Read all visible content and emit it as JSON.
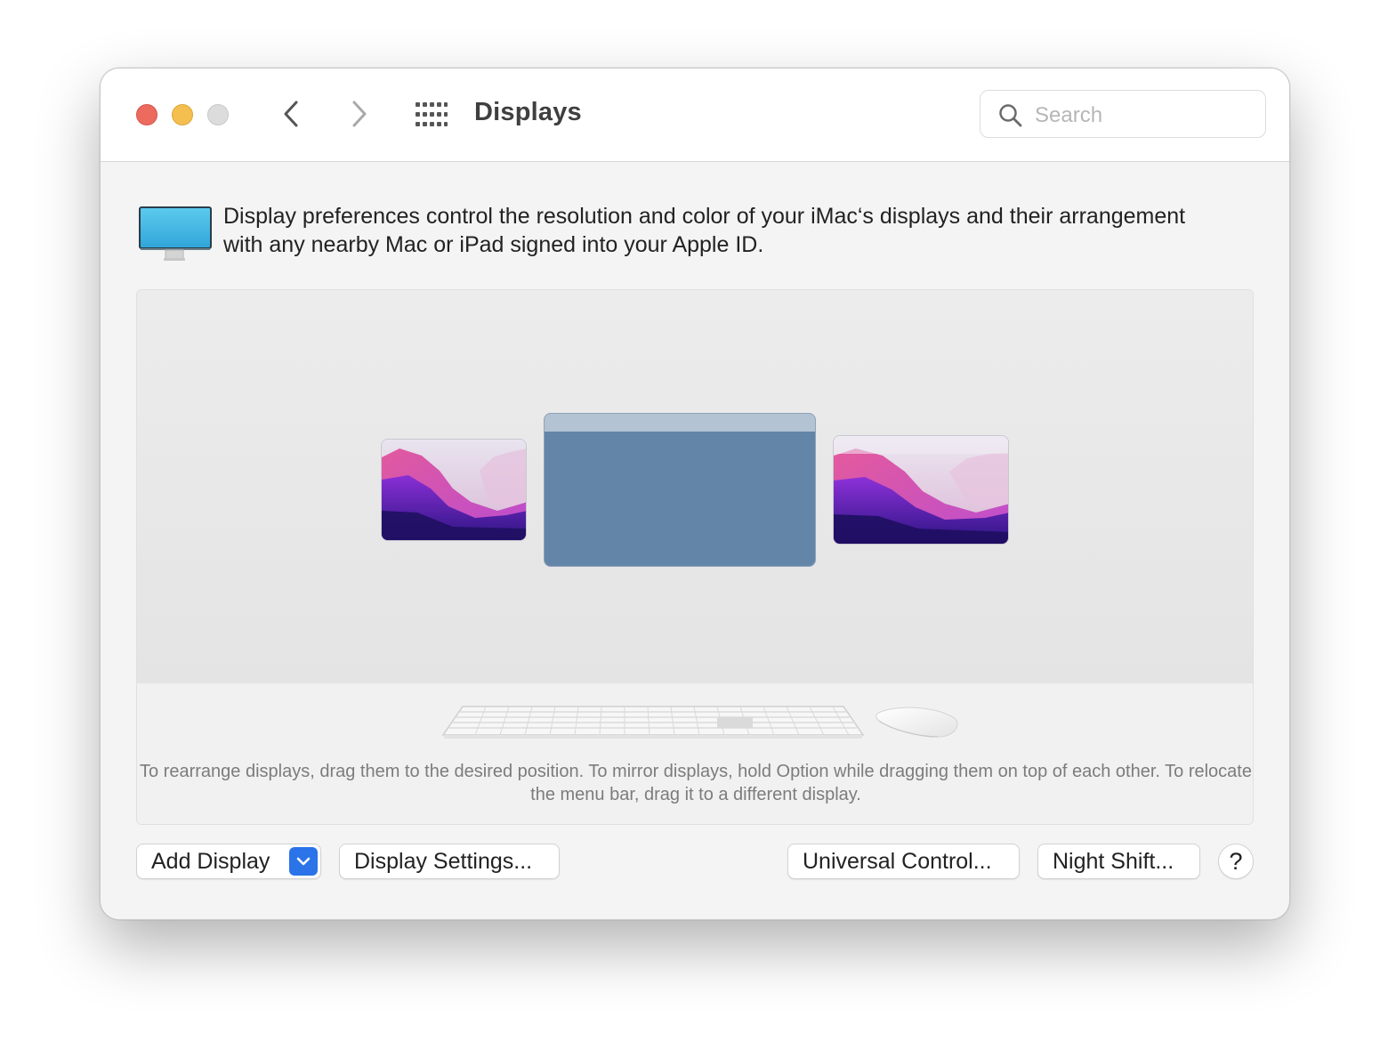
{
  "window": {
    "title": "Displays"
  },
  "search": {
    "placeholder": "Search"
  },
  "description": {
    "text": "Display preferences control the resolution and color of your iMac‘s displays and their arrangement with any nearby Mac or iPad signed into your Apple ID."
  },
  "arrangement": {
    "hint": "To rearrange displays, drag them to the desired position. To mirror displays, hold Option while dragging them on top of each other. To relocate the menu bar, drag it to a different display."
  },
  "buttons": {
    "add_display": "Add Display",
    "display_settings": "Display Settings...",
    "universal_control": "Universal Control...",
    "night_shift": "Night Shift...",
    "help": "?"
  },
  "colors": {
    "close": "#ed6a5e",
    "minimize": "#f5bf4f",
    "zoom_disabled": "#dcdcdc",
    "accent": "#2a73e8",
    "main_display": "#6385a8"
  },
  "icons": {
    "back": "chevron-left-icon",
    "forward": "chevron-right-icon",
    "show_all": "grid-icon",
    "search": "magnifier-icon",
    "imac": "imac-icon",
    "dropdown": "chevron-down-icon"
  }
}
